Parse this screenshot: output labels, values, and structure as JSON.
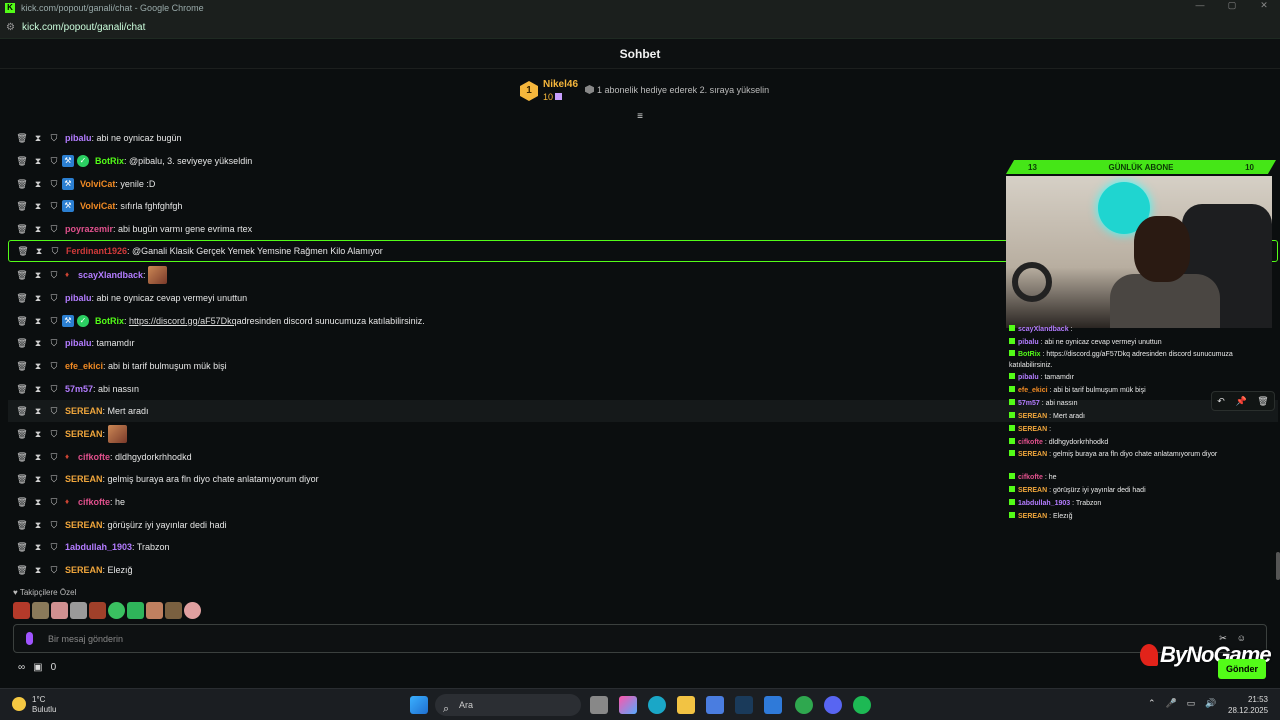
{
  "window": {
    "title": "kick.com/popout/ganali/chat - Google Chrome",
    "url": "kick.com/popout/ganali/chat"
  },
  "header": {
    "title": "Sohbet"
  },
  "pinned": {
    "rank": "1",
    "name": "Nikel46",
    "value": "10",
    "promo": "1 abonelik hediye ederek 2. sıraya yükselin"
  },
  "messages": [
    {
      "user": "pibalu",
      "color": "#b37cff",
      "text": ": abi ne oynicaz bugün",
      "badges": []
    },
    {
      "user": "BotRix",
      "color": "#53fc18",
      "text": ": @pibalu, 3. seviyeye yükseldin",
      "badges": [
        "blue",
        "green"
      ]
    },
    {
      "user": "VolviCat",
      "color": "#f08a24",
      "text": ": yenile :D",
      "badges": [
        "blue"
      ]
    },
    {
      "user": "VolviCat",
      "color": "#f08a24",
      "text": ": sıfırla fghfghfgh",
      "badges": [
        "blue"
      ]
    },
    {
      "user": "poyrazemir",
      "color": "#e0508c",
      "text": ": abi bugün varmı gene evrima rtex",
      "badges": []
    },
    {
      "user": "Ferdinant1926",
      "color": "#d03a3a",
      "text": ": @Ganali Klasik Gerçek Yemek Yemsine Rağmen Kilo Alamıyor",
      "badges": []
    },
    {
      "user": "scayXlandback",
      "color": "#b37cff",
      "text": ":",
      "badges": [
        "red"
      ],
      "emote": true
    },
    {
      "user": "pibalu",
      "color": "#b37cff",
      "text": ": abi ne oynicaz cevap vermeyi unuttun",
      "badges": []
    },
    {
      "user": "BotRix",
      "color": "#53fc18",
      "text": ":",
      "link": "https://discord.gg/aF57Dkq",
      "text2": " adresinden discord sunucumuza katılabilirsiniz.",
      "badges": [
        "blue",
        "green"
      ]
    },
    {
      "user": "pibalu",
      "color": "#b37cff",
      "text": ": tamamdır",
      "badges": []
    },
    {
      "user": "efe_ekici",
      "color": "#f08a24",
      "text": ": abi bi tarif bulmuşum mük bişi",
      "badges": []
    },
    {
      "user": "57m57",
      "color": "#b37cff",
      "text": ": abi nassın",
      "badges": []
    },
    {
      "user": "SEREAN",
      "color": "#f0a63c",
      "text": ": Mert aradı",
      "badges": []
    },
    {
      "user": "SEREAN",
      "color": "#f0a63c",
      "text": ":",
      "badges": [],
      "emote": true
    },
    {
      "user": "cifkofte",
      "color": "#e0508c",
      "text": ": dldhgydorkrhhodkd",
      "badges": [
        "red"
      ]
    },
    {
      "user": "SEREAN",
      "color": "#f0a63c",
      "text": ": gelmiş buraya ara fln diyo chate anlatamıyorum diyor",
      "badges": []
    },
    {
      "user": "cifkofte",
      "color": "#e0508c",
      "text": ": he",
      "badges": [
        "red"
      ]
    },
    {
      "user": "SEREAN",
      "color": "#f0a63c",
      "text": ": görüşürz iyi yayınlar dedi hadi",
      "badges": []
    },
    {
      "user": "1abdullah_1903",
      "color": "#b37cff",
      "text": ": Trabzon",
      "badges": []
    },
    {
      "user": "SEREAN",
      "color": "#f0a63c",
      "text": ": Elezığ",
      "badges": []
    }
  ],
  "overlay": {
    "left_num": "13",
    "title": "GÜNLÜK ABONE",
    "right_num": "10"
  },
  "minichat": [
    {
      "user": "scayXlandback",
      "color": "#b37cff",
      "text": " :"
    },
    {
      "user": "pibalu",
      "color": "#b37cff",
      "text": " : abi ne oynicaz cevap vermeyi unuttun"
    },
    {
      "user": "BotRix",
      "color": "#53fc18",
      "text": " : https://discord.gg/aF57Dkq adresinden discord sunucumuza katılabilirsiniz."
    },
    {
      "user": "pibalu",
      "color": "#b37cff",
      "text": " : tamamdır"
    },
    {
      "user": "efe_ekici",
      "color": "#f08a24",
      "text": " : abi bi tarif bulmuşum mük bişi"
    },
    {
      "user": "57m57",
      "color": "#b37cff",
      "text": " : abi nassın"
    },
    {
      "user": "SEREAN",
      "color": "#f0a63c",
      "text": " : Mert aradı"
    },
    {
      "user": "SEREAN",
      "color": "#f0a63c",
      "text": " :"
    },
    {
      "user": "cifkofte",
      "color": "#e0508c",
      "text": " : dldhgydorkrhhodkd"
    },
    {
      "user": "SEREAN",
      "color": "#f0a63c",
      "text": " : gelmiş buraya ara fln diyo chate anlatamıyorum diyor"
    },
    {
      "user": "cifkofte",
      "color": "#e0508c",
      "text": " : he"
    },
    {
      "user": "SEREAN",
      "color": "#f0a63c",
      "text": " : görüşürz iyi yayınlar dedi hadi"
    },
    {
      "user": "1abdullah_1903",
      "color": "#b37cff",
      "text": " : Trabzon"
    },
    {
      "user": "SEREAN",
      "color": "#f0a63c",
      "text": " : Elezığ"
    }
  ],
  "footer": {
    "follow_label": "Takipçilere Özel",
    "placeholder": "Bir mesaj gönderin",
    "count": "0",
    "send": "Gönder",
    "brand": "ByNoGame"
  },
  "taskbar": {
    "temp": "1°C",
    "weather": "Bulutlu",
    "search": "Ara",
    "time": "21:53",
    "date": "28.12.2025"
  }
}
